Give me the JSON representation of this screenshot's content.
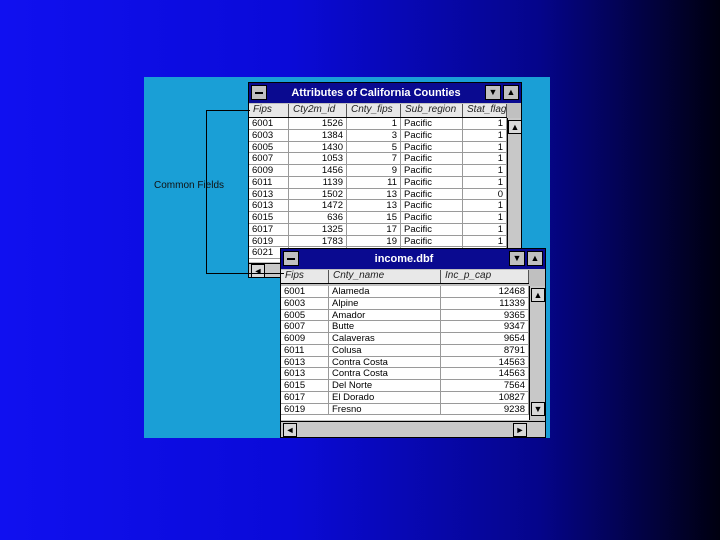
{
  "annotation": "Common Fields",
  "attributes_window": {
    "title": "Attributes of California Counties",
    "headers": [
      "Fips",
      "Cty2m_id",
      "Cnty_fips",
      "Sub_region",
      "Stat_flag"
    ],
    "rows": [
      [
        "6001",
        "1526",
        "1",
        "Pacific",
        "1"
      ],
      [
        "6003",
        "1384",
        "3",
        "Pacific",
        "1"
      ],
      [
        "6005",
        "1430",
        "5",
        "Pacific",
        "1"
      ],
      [
        "6007",
        "1053",
        "7",
        "Pacific",
        "1"
      ],
      [
        "6009",
        "1456",
        "9",
        "Pacific",
        "1"
      ],
      [
        "6011",
        "1139",
        "11",
        "Pacific",
        "1"
      ],
      [
        "6013",
        "1502",
        "13",
        "Pacific",
        "0"
      ],
      [
        "6013",
        "1472",
        "13",
        "Pacific",
        "1"
      ],
      [
        "6015",
        "636",
        "15",
        "Pacific",
        "1"
      ],
      [
        "6017",
        "1325",
        "17",
        "Pacific",
        "1"
      ],
      [
        "6019",
        "1783",
        "19",
        "Pacific",
        "1"
      ],
      [
        "6021",
        "",
        "",
        "",
        ""
      ]
    ]
  },
  "income_window": {
    "title": "income.dbf",
    "headers": [
      "Fips",
      "Cnty_name",
      "Inc_p_cap"
    ],
    "rows": [
      [
        "6001",
        "Alameda",
        "12468"
      ],
      [
        "6003",
        "Alpine",
        "11339"
      ],
      [
        "6005",
        "Amador",
        "9365"
      ],
      [
        "6007",
        "Butte",
        "9347"
      ],
      [
        "6009",
        "Calaveras",
        "9654"
      ],
      [
        "6011",
        "Colusa",
        "8791"
      ],
      [
        "6013",
        "Contra Costa",
        "14563"
      ],
      [
        "6013",
        "Contra Costa",
        "14563"
      ],
      [
        "6015",
        "Del Norte",
        "7564"
      ],
      [
        "6017",
        "El Dorado",
        "10827"
      ],
      [
        "6019",
        "Fresno",
        "9238"
      ]
    ]
  },
  "icons": {
    "scroll_up": "▲",
    "scroll_down": "▼",
    "scroll_left": "◄",
    "scroll_right": "►",
    "minimize": "▼",
    "maximize": "▲"
  }
}
